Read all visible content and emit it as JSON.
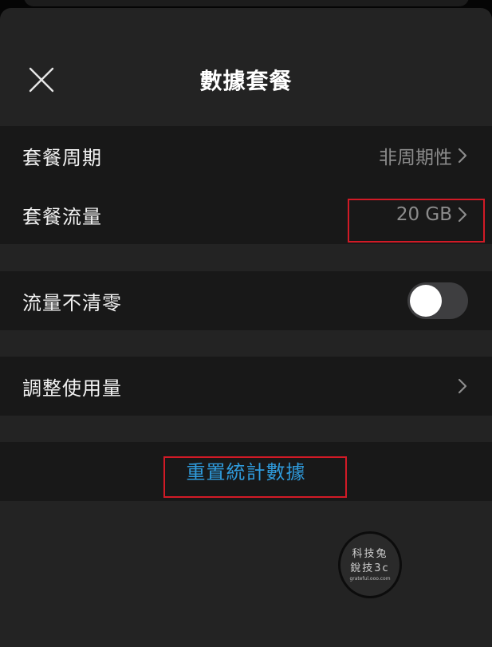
{
  "header": {
    "title": "數據套餐"
  },
  "plan": {
    "cycle_label": "套餐周期",
    "cycle_value": "非周期性",
    "data_label": "套餐流量",
    "data_value": "20 GB"
  },
  "rollover": {
    "label": "流量不清零",
    "enabled": false
  },
  "adjust": {
    "label": "調整使用量"
  },
  "reset": {
    "label": "重置統計數據"
  },
  "watermark": {
    "line1": "科技兔",
    "line2": "銳技3c",
    "url": "grateful.ooo.com"
  },
  "colors": {
    "accent_link": "#2f9bdc",
    "highlight_box": "#d11a26",
    "sheet_bg": "#232323",
    "row_bg": "#181818"
  }
}
